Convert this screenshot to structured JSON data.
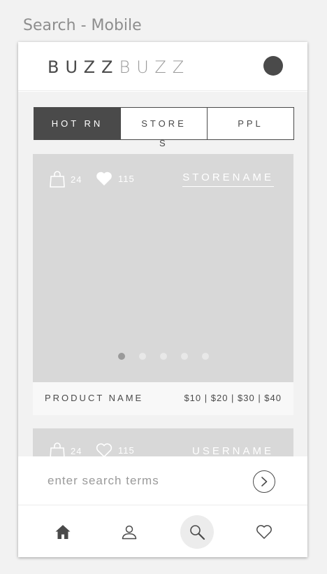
{
  "frame": {
    "title": "Search - Mobile"
  },
  "header": {
    "logo_bold": "BUZZ",
    "logo_light": "BUZZ",
    "avatar_icon": "user-avatar"
  },
  "tabs": [
    {
      "label": "HOT RN",
      "active": true
    },
    {
      "label": "STORE",
      "active": false
    },
    {
      "label": "PPL",
      "active": false
    }
  ],
  "tabs_overflow": "S",
  "cards": [
    {
      "bag_count": "24",
      "like_count": "115",
      "link_label": "STORENAME",
      "carousel": {
        "count": 5,
        "active_index": 0
      },
      "product_name": "PRODUCT NAME",
      "prices": "$10 | $20 | $30 | $40"
    },
    {
      "bag_count": "24",
      "like_count": "115",
      "link_label": "USERNAME"
    }
  ],
  "search": {
    "placeholder": "enter search terms",
    "value": "",
    "go_icon": "chevron-right-circle"
  },
  "tabbar": [
    {
      "name": "home",
      "icon": "home-icon",
      "active": false
    },
    {
      "name": "profile",
      "icon": "user-icon",
      "active": false
    },
    {
      "name": "search",
      "icon": "search-icon",
      "active": true
    },
    {
      "name": "favorites",
      "icon": "heart-icon",
      "active": false
    }
  ],
  "colors": {
    "dark": "#4a4a4a",
    "placeholder_image": "#d8d8d8",
    "background": "#f2f2f2"
  }
}
